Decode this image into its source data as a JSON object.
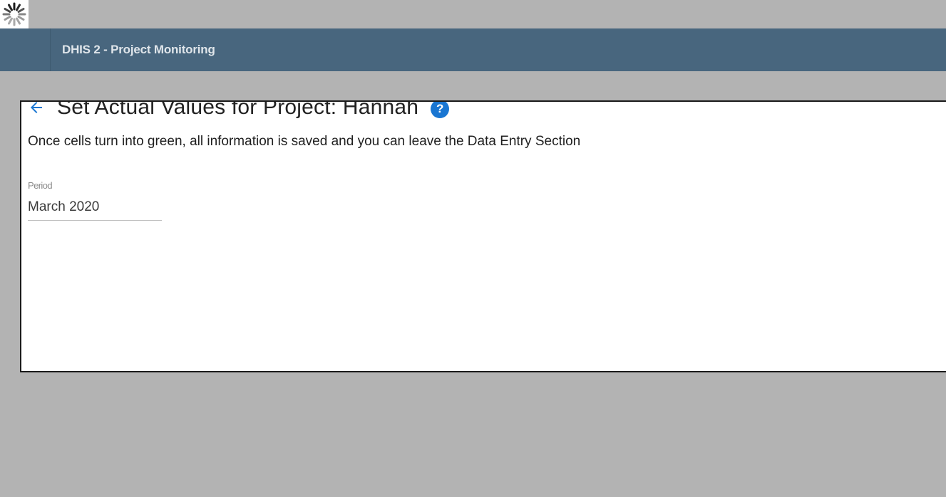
{
  "loading_indicator": {
    "icon": "spinner-icon"
  },
  "header": {
    "title": "DHIS 2 - Project Monitoring",
    "color": "#48667e"
  },
  "card": {
    "back_icon": "arrow-back-icon",
    "title": "Set Actual Values for Project: Hannah",
    "help_icon": "help-icon",
    "help_glyph": "?",
    "info": "Once cells turn into green, all information is saved and you can leave the Data Entry Section",
    "period": {
      "label": "Period",
      "value": "March 2020"
    }
  },
  "colors": {
    "accent": "#1976d2",
    "background": "#b3b3b3"
  }
}
